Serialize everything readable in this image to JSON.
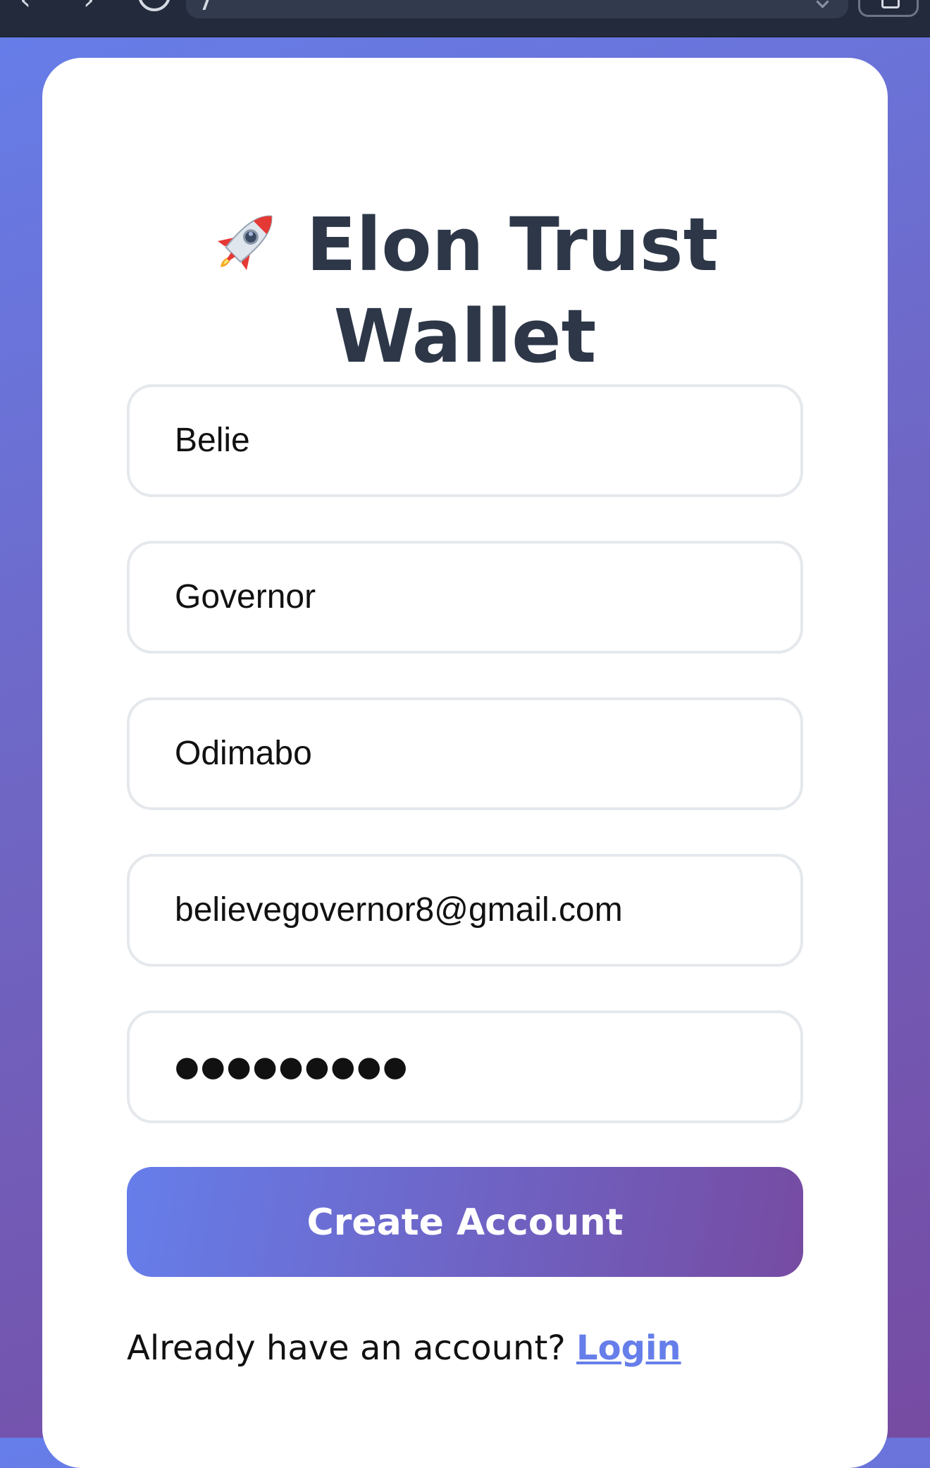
{
  "app": {
    "title_line1": "Elon Trust",
    "title_line2": "Wallet",
    "title_icon": "rocket-icon"
  },
  "form": {
    "first_name": "Belie",
    "last_name": "Governor",
    "other_name": "Odimabo",
    "email": "believegovernor8@gmail.com",
    "password_mask": "●●●●●●●●●",
    "submit_label": "Create Account"
  },
  "footer": {
    "prompt": "Already have an account?",
    "login_label": "Login"
  },
  "colors": {
    "accent_start": "#667eea",
    "accent_end": "#764ba2",
    "title_text": "#2d3748",
    "card_background": "#ffffff"
  }
}
